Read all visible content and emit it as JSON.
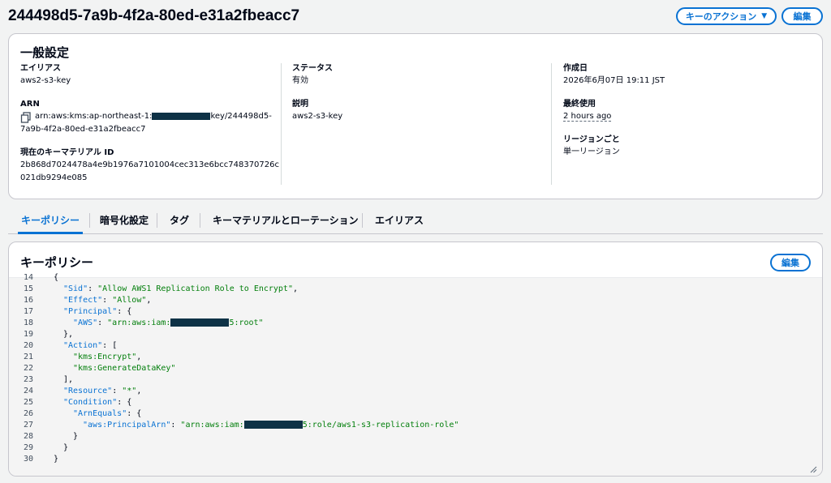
{
  "header": {
    "title": "244498d5-7a9b-4f2a-80ed-e31a2fbeacc7",
    "actions_label": "キーのアクション",
    "edit_label": "編集"
  },
  "general": {
    "heading": "一般設定",
    "alias_label": "エイリアス",
    "alias_value": "aws2-s3-key",
    "arn_label": "ARN",
    "arn_prefix": "arn:aws:kms:ap-northeast-1:",
    "arn_suffix_line1": "key/244498d5-",
    "arn_suffix_line2": "7a9b-4f2a-80ed-e31a2fbeacc7",
    "key_material_label": "現在のキーマテリアル ID",
    "key_material_value": "2b868d7024478a4e9b1976a7101004cec313e6bcc748370726c021db9294e085",
    "status_label": "ステータス",
    "status_value": "有効",
    "description_label": "説明",
    "description_value": "aws2-s3-key",
    "created_label": "作成日",
    "created_value": "2026年6月07日 19:11 JST",
    "last_used_label": "最終使用",
    "last_used_value": "2 hours ago",
    "region_label": "リージョンごと",
    "region_value": "単一リージョン"
  },
  "tabs": [
    {
      "label": "キーポリシー",
      "active": true
    },
    {
      "label": "暗号化設定",
      "active": false
    },
    {
      "label": "タグ",
      "active": false
    },
    {
      "label": "キーマテリアルとローテーション",
      "active": false
    },
    {
      "label": "エイリアス",
      "active": false
    }
  ],
  "policy": {
    "heading": "キーポリシー",
    "edit_label": "編集",
    "lines": [
      {
        "n": "14",
        "indent": 4,
        "parts": [
          [
            "p",
            "{"
          ]
        ]
      },
      {
        "n": "15",
        "indent": 6,
        "parts": [
          [
            "k",
            "\"Sid\""
          ],
          [
            "p",
            ": "
          ],
          [
            "s",
            "\"Allow AWS1 Replication Role to Encrypt\""
          ],
          [
            "p",
            ","
          ]
        ]
      },
      {
        "n": "16",
        "indent": 6,
        "parts": [
          [
            "k",
            "\"Effect\""
          ],
          [
            "p",
            ": "
          ],
          [
            "s",
            "\"Allow\""
          ],
          [
            "p",
            ","
          ]
        ]
      },
      {
        "n": "17",
        "indent": 6,
        "parts": [
          [
            "k",
            "\"Principal\""
          ],
          [
            "p",
            ": {"
          ]
        ]
      },
      {
        "n": "18",
        "indent": 8,
        "parts": [
          [
            "k",
            "\"AWS\""
          ],
          [
            "p",
            ": "
          ],
          [
            "s",
            "\"arn:aws:iam:"
          ],
          [
            "r",
            ""
          ],
          [
            "s",
            "5:root\""
          ]
        ]
      },
      {
        "n": "19",
        "indent": 6,
        "parts": [
          [
            "p",
            "},"
          ]
        ]
      },
      {
        "n": "20",
        "indent": 6,
        "parts": [
          [
            "k",
            "\"Action\""
          ],
          [
            "p",
            ": ["
          ]
        ]
      },
      {
        "n": "21",
        "indent": 8,
        "parts": [
          [
            "s",
            "\"kms:Encrypt\""
          ],
          [
            "p",
            ","
          ]
        ]
      },
      {
        "n": "22",
        "indent": 8,
        "parts": [
          [
            "s",
            "\"kms:GenerateDataKey\""
          ]
        ]
      },
      {
        "n": "23",
        "indent": 6,
        "parts": [
          [
            "p",
            "],"
          ]
        ]
      },
      {
        "n": "24",
        "indent": 6,
        "parts": [
          [
            "k",
            "\"Resource\""
          ],
          [
            "p",
            ": "
          ],
          [
            "s",
            "\"*\""
          ],
          [
            "p",
            ","
          ]
        ]
      },
      {
        "n": "25",
        "indent": 6,
        "parts": [
          [
            "k",
            "\"Condition\""
          ],
          [
            "p",
            ": {"
          ]
        ]
      },
      {
        "n": "26",
        "indent": 8,
        "parts": [
          [
            "k",
            "\"ArnEquals\""
          ],
          [
            "p",
            ": {"
          ]
        ]
      },
      {
        "n": "27",
        "indent": 10,
        "parts": [
          [
            "k",
            "\"aws:PrincipalArn\""
          ],
          [
            "p",
            ": "
          ],
          [
            "s",
            "\"arn:aws:iam:"
          ],
          [
            "r",
            ""
          ],
          [
            "s",
            "5:role/aws1-s3-replication-role\""
          ]
        ]
      },
      {
        "n": "28",
        "indent": 8,
        "parts": [
          [
            "p",
            "}"
          ]
        ]
      },
      {
        "n": "29",
        "indent": 6,
        "parts": [
          [
            "p",
            "}"
          ]
        ]
      },
      {
        "n": "30",
        "indent": 4,
        "parts": [
          [
            "p",
            "}"
          ]
        ]
      }
    ]
  },
  "colors": {
    "accent": "#0972d3",
    "string": "#037f0c",
    "redaction": "#0e3246"
  }
}
